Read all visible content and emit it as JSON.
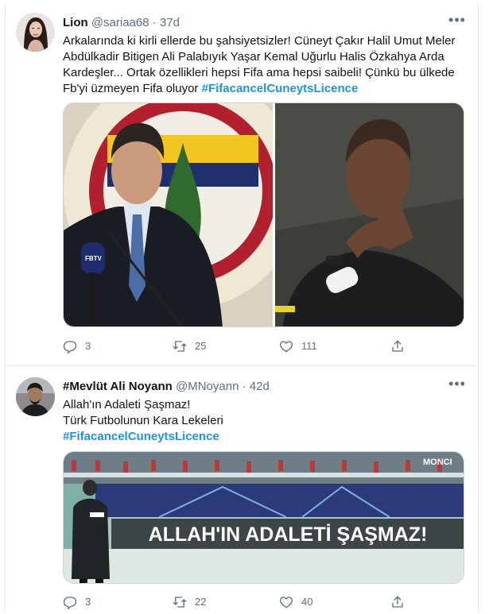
{
  "tweets": [
    {
      "author_name": "Lion",
      "handle": "@sariaa68",
      "separator": "·",
      "time": "37d",
      "text_lines": [
        "Arkalarında ki kirli ellerde bu şahsiyetsizler! Cüneyt Çakır Halil Umut Meler",
        "Abdülkadir Bitigen Ali Palabıyık Yaşar Kemal Uğurlu Halis Özkahya Arda",
        "Kardeşler... Ortak özellikleri hepsi Fifa ama hepsi saibeli! Çünkü bu ülkede",
        "Fb'yi üzmeyen Fifa oluyor "
      ],
      "hashtag": "#FifacancelCuneytsLicence",
      "replies": "3",
      "retweets": "25",
      "likes": "111",
      "media_image_text": "FBTV"
    },
    {
      "author_name": "#Mevlüt Ali Noyann",
      "handle": "@MNoyann",
      "separator": "·",
      "time": "42d",
      "text_lines": [
        "Allah'ın Adaleti Şaşmaz!",
        "Türk Futbolunun Kara Lekeleri"
      ],
      "hashtag": "#FifacancelCuneytsLicence",
      "replies": "3",
      "retweets": "22",
      "likes": "40",
      "media_banner": "ALLAH'IN ADALETİ ŞAŞMAZ!",
      "media_watermark": "MONCI"
    }
  ],
  "icons": [
    "reply-icon",
    "retweet-icon",
    "like-icon",
    "share-icon",
    "more-icon"
  ],
  "colors": {
    "hashtag": "#1b95e0",
    "secondary": "#5b7083",
    "border": "#e1e8ed"
  }
}
